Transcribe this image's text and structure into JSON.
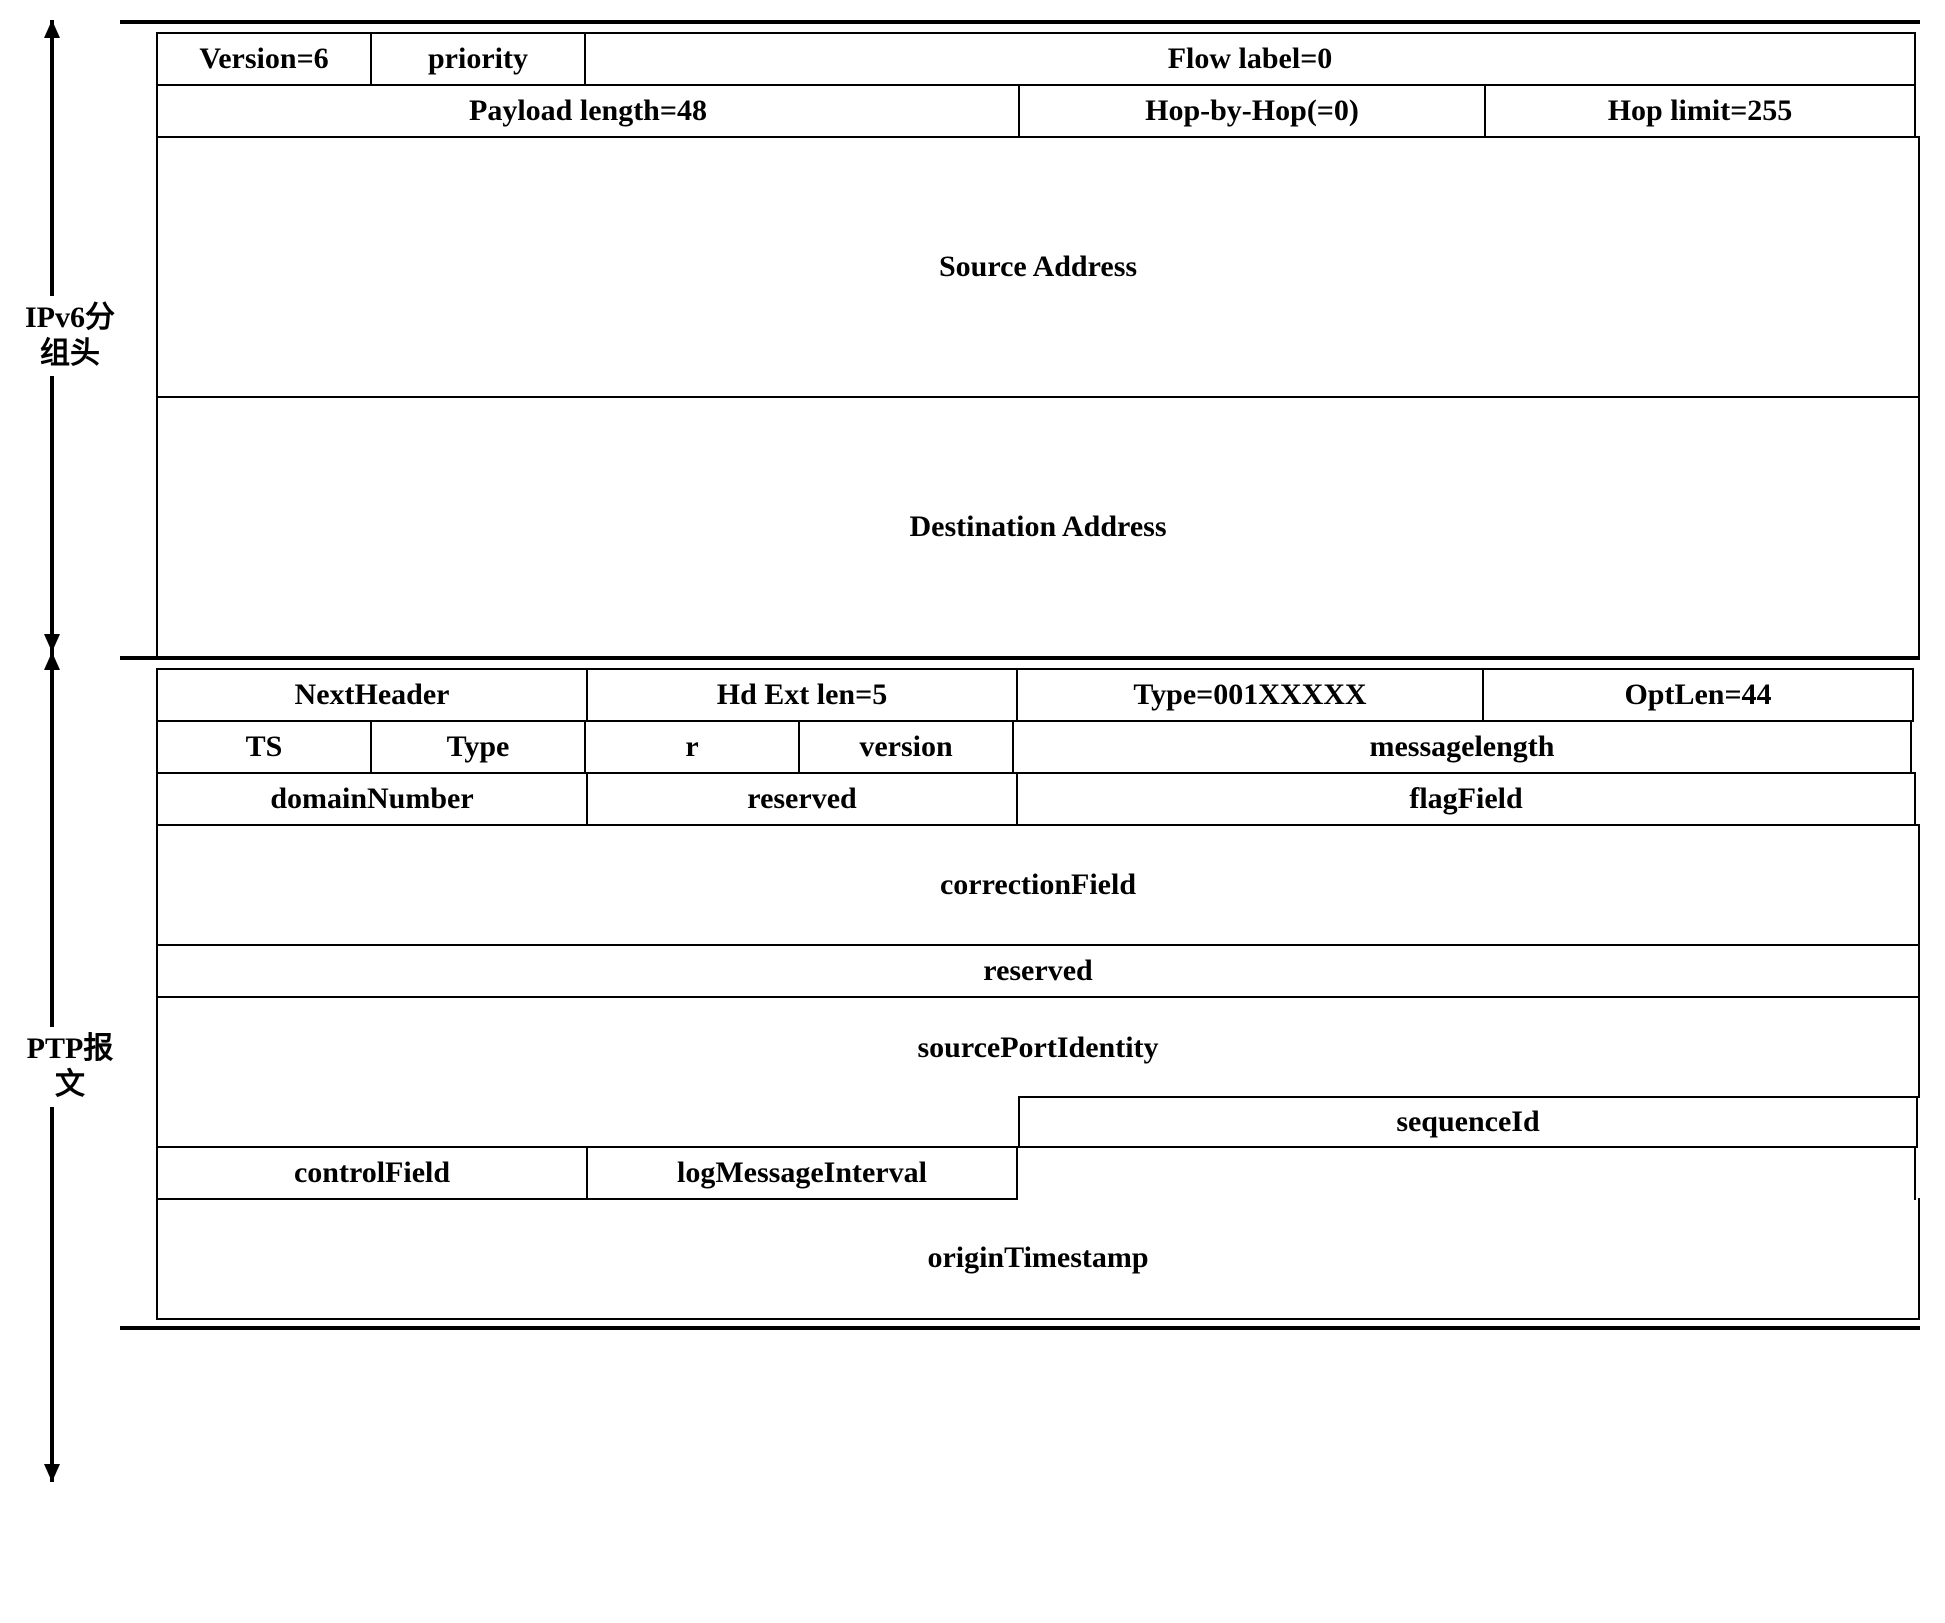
{
  "labels": {
    "ipv6": "IPv6分组头",
    "ptp": "PTP报文"
  },
  "ipv6": {
    "version": "Version=6",
    "priority": "priority",
    "flowlabel": "Flow label=0",
    "payloadlen": "Payload length=48",
    "hopbyhop": "Hop-by-Hop(=0)",
    "hoplimit": "Hop limit=255",
    "srcaddr": "Source Address",
    "dstaddr": "Destination Address"
  },
  "ptp": {
    "nextheader": "NextHeader",
    "hdextlen": "Hd Ext len=5",
    "type": "Type=001XXXXX",
    "optlen": "OptLen=44",
    "ts": "TS",
    "ptptype": "Type",
    "r": "r",
    "version": "version",
    "msglen": "messagelength",
    "domainnum": "domainNumber",
    "reserved1": "reserved",
    "flagfield": "flagField",
    "correction": "correctionField",
    "reserved2": "reserved",
    "srcport": "sourcePortIdentity",
    "seqid": "sequenceId",
    "ctrlfield": "controlField",
    "logmsgint": "logMessageInterval",
    "origints": "originTimestamp"
  }
}
